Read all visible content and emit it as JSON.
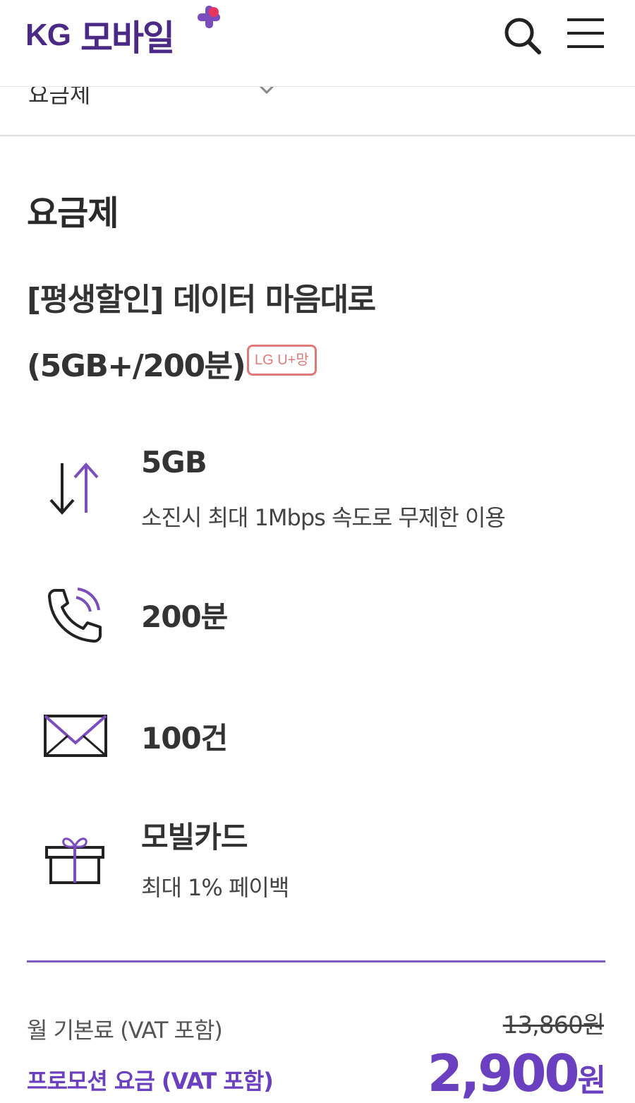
{
  "header": {
    "logo_kg": "KG",
    "logo_text": "모바일",
    "search_icon": "search-icon",
    "menu_icon": "hamburger-menu-icon",
    "brand_color": "#4b2a86"
  },
  "sub_nav": {
    "label": "요금제",
    "chevron_icon": "chevron-down-icon"
  },
  "section_title": "요금제",
  "plan": {
    "name_line1": "[평생할인] 데이터 마음대로",
    "name_line2": "(5GB+/200분)",
    "network_badge": "LG U+망"
  },
  "features": [
    {
      "icon": "data-transfer-icon",
      "title": "5GB",
      "desc": "소진시 최대 1Mbps 속도로 무제한 이용"
    },
    {
      "icon": "phone-call-icon",
      "title": "200분"
    },
    {
      "icon": "envelope-icon",
      "title": "100건"
    },
    {
      "icon": "gift-icon",
      "title": "모빌카드",
      "desc": "최대 1% 페이백"
    }
  ],
  "pricing": {
    "base_label": "월 기본료 (VAT 포함)",
    "base_price": "13,860원",
    "promo_label": "프로모션 요금 (VAT 포함)",
    "promo_price": "2,900",
    "promo_unit": "원",
    "accent_color": "#6a3fc0"
  }
}
